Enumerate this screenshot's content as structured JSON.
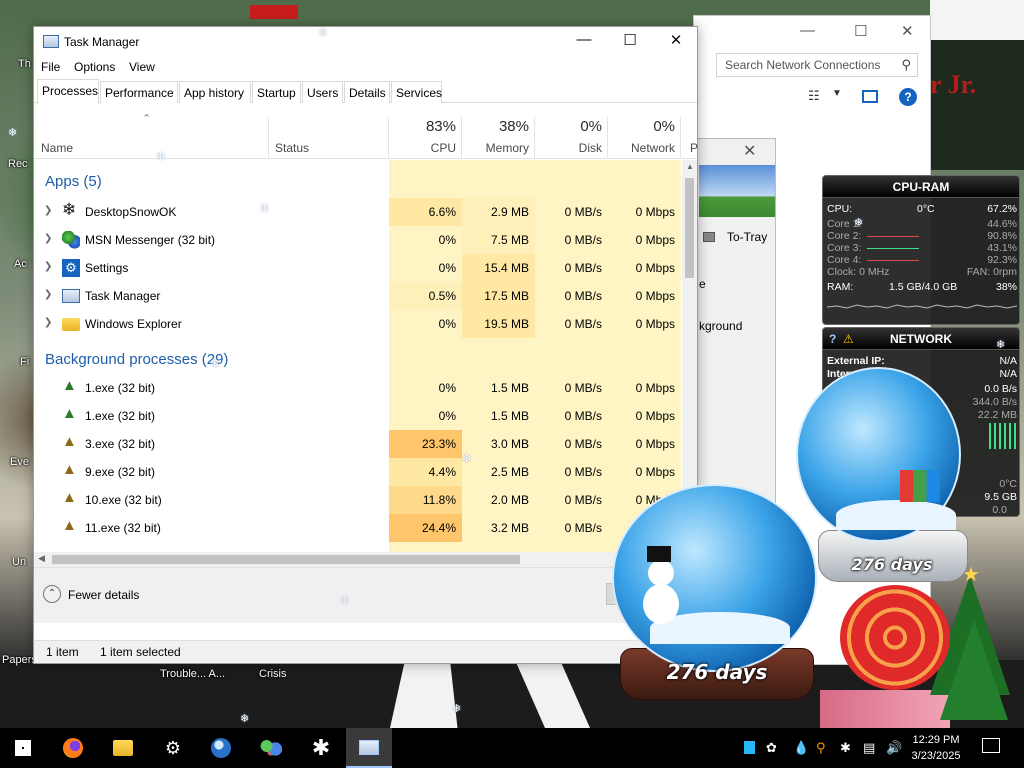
{
  "desktop": {
    "labels": [
      "Th",
      "Rec",
      "Ac",
      "Fi",
      "Eve",
      "Un",
      "Papers"
    ],
    "taskbar_bg_labels": [
      "Trouble... A...",
      "Crisis"
    ],
    "banner_text": "r Jr."
  },
  "explorer": {
    "search_placeholder": "Search Network Connections"
  },
  "dialog": {
    "tray_label": "To-Tray",
    "text1": "e",
    "text2": "kground"
  },
  "task_manager": {
    "title": "Task Manager",
    "menu": [
      "File",
      "Options",
      "View"
    ],
    "tabs": [
      "Processes",
      "Performance",
      "App history",
      "Startup",
      "Users",
      "Details",
      "Services"
    ],
    "active_tab": "Processes",
    "columns": {
      "name": "Name",
      "status": "Status",
      "cpu": {
        "pct": "83%",
        "label": "CPU"
      },
      "memory": {
        "pct": "38%",
        "label": "Memory"
      },
      "disk": {
        "pct": "0%",
        "label": "Disk"
      },
      "network": {
        "pct": "0%",
        "label": "Network"
      },
      "extra": "P"
    },
    "groups": [
      {
        "title": "Apps (5)",
        "rows": [
          {
            "name": "DesktopSnowOK",
            "cpu": "6.6%",
            "memory": "2.9 MB",
            "disk": "0 MB/s",
            "network": "0 Mbps",
            "icon": "snowflake-icon"
          },
          {
            "name": "MSN Messenger (32 bit)",
            "cpu": "0%",
            "memory": "7.5 MB",
            "disk": "0 MB/s",
            "network": "0 Mbps",
            "icon": "msn-icon"
          },
          {
            "name": "Settings",
            "cpu": "0%",
            "memory": "15.4 MB",
            "disk": "0 MB/s",
            "network": "0 Mbps",
            "icon": "gear-icon"
          },
          {
            "name": "Task Manager",
            "cpu": "0.5%",
            "memory": "17.5 MB",
            "disk": "0 MB/s",
            "network": "0 Mbps",
            "icon": "taskmanager-icon"
          },
          {
            "name": "Windows Explorer",
            "cpu": "0%",
            "memory": "19.5 MB",
            "disk": "0 MB/s",
            "network": "0 Mbps",
            "icon": "folder-icon"
          }
        ]
      },
      {
        "title": "Background processes (29)",
        "rows": [
          {
            "name": "1.exe (32 bit)",
            "cpu": "0%",
            "memory": "1.5 MB",
            "disk": "0 MB/s",
            "network": "0 Mbps",
            "icon": "tree-icon"
          },
          {
            "name": "1.exe (32 bit)",
            "cpu": "0%",
            "memory": "1.5 MB",
            "disk": "0 MB/s",
            "network": "0 Mbps",
            "icon": "tree-icon"
          },
          {
            "name": "3.exe (32 bit)",
            "cpu": "23.3%",
            "memory": "3.0 MB",
            "disk": "0 MB/s",
            "network": "0 Mbps",
            "icon": "tree-icon"
          },
          {
            "name": "9.exe (32 bit)",
            "cpu": "4.4%",
            "memory": "2.5 MB",
            "disk": "0 MB/s",
            "network": "0 Mbps",
            "icon": "tree-icon"
          },
          {
            "name": "10.exe (32 bit)",
            "cpu": "11.8%",
            "memory": "2.0 MB",
            "disk": "0 MB/s",
            "network": "0 Mbps",
            "icon": "tree-icon"
          },
          {
            "name": "11.exe (32 bit)",
            "cpu": "24.4%",
            "memory": "3.2 MB",
            "disk": "0 MB/s",
            "network": "0 Mbps",
            "icon": "tree-icon"
          }
        ]
      }
    ],
    "fewer_details": "Fewer details",
    "status_items": "1 item",
    "status_selected": "1 item selected"
  },
  "cpu_ram_gadget": {
    "title": "CPU-RAM",
    "cpu": {
      "label": "CPU:",
      "temp": "0°C",
      "value": "67.2%"
    },
    "cores": [
      {
        "label": "Core 1:",
        "value": "44.6%"
      },
      {
        "label": "Core 2:",
        "value": "90.8%"
      },
      {
        "label": "Core 3:",
        "value": "43.1%"
      },
      {
        "label": "Core 4:",
        "value": "92.3%"
      }
    ],
    "clock": {
      "label": "Clock: 0 MHz",
      "fan": "FAN: 0rpm"
    },
    "ram": {
      "label": "RAM:",
      "amount": "1.5 GB/4.0 GB",
      "value": "38%"
    }
  },
  "network_gadget": {
    "title": "NETWORK",
    "external_ip": {
      "label": "External IP:",
      "value": "N/A"
    },
    "internal": {
      "label": "Intern",
      "value": "N/A"
    },
    "rows": [
      "0.0 B/s",
      "344.0 B/s",
      "22.2 MB"
    ],
    "temp": "0°C",
    "size": "9.5 GB",
    "small": "0.0"
  },
  "snow_globes": {
    "left_days": "276 days",
    "right_days": "276 days"
  },
  "taskbar": {
    "time": "12:29 PM",
    "date": "3/23/2025"
  },
  "colors": {
    "accent": "#1e5fa8",
    "heat_light": "#fff4c4",
    "heat_mid": "#ffe8a3",
    "heat_high": "#ffd27a"
  }
}
